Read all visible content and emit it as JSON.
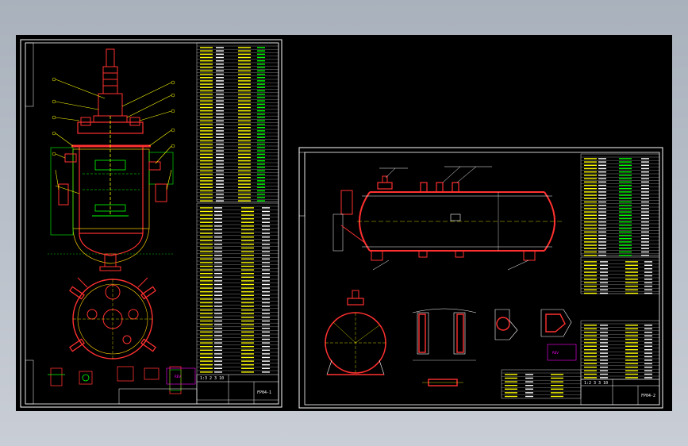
{
  "sheet_left": {
    "title_block": {
      "code": "FP04-1",
      "row_label": "1:3 2 3 10"
    },
    "stamp_box": "REV",
    "part_labels": [
      "1",
      "2",
      "3",
      "4",
      "5",
      "6",
      "7",
      "8",
      "9",
      "10",
      "11",
      "12",
      "13",
      "14",
      "15",
      "16",
      "17",
      "18",
      "19",
      "20",
      "21",
      "22",
      "23",
      "24",
      "25",
      "26",
      "27",
      "28",
      "29",
      "30",
      "31",
      "32",
      "33",
      "34",
      "35",
      "36",
      "37",
      "38",
      "39",
      "40",
      "41",
      "42",
      "43",
      "44",
      "45",
      "46",
      "47",
      "48",
      "49",
      "50",
      "51",
      "52",
      "53",
      "54",
      "55",
      "56",
      "57",
      "58",
      "59",
      "60"
    ]
  },
  "sheet_right": {
    "title_block": {
      "code": "FP04-2",
      "row_label": "1:2 3 3 10"
    },
    "stamp_box": "REV",
    "nozzles": [
      "a",
      "b",
      "c",
      "d",
      "e",
      "f",
      "g"
    ]
  },
  "colors": {
    "background_top": "#a9b1bc",
    "viewport": "#000000",
    "frame": "#ffffff",
    "shell": "#ff2020",
    "annotation": "#ffff00",
    "detail": "#00ff00",
    "cyan": "#00e0e0",
    "magenta": "#ff00ff"
  }
}
